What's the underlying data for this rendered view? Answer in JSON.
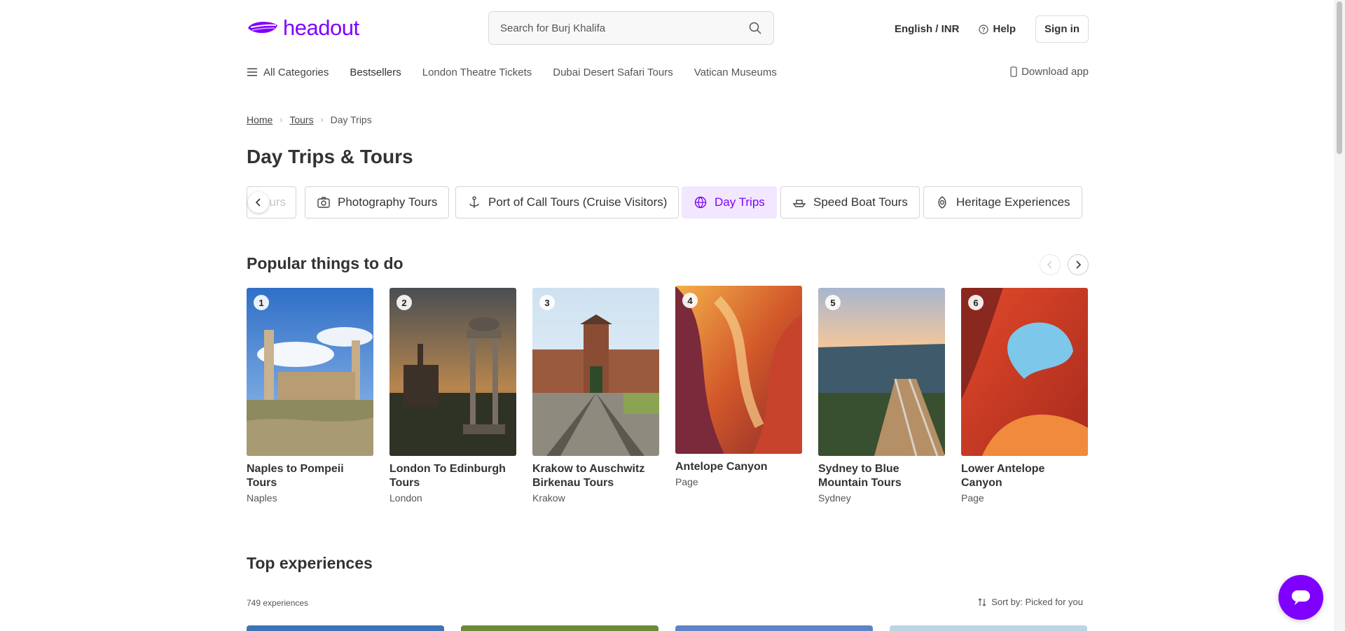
{
  "header": {
    "logo_text": "headout",
    "search_placeholder": "Search for Burj Khalifa",
    "language": "English / INR",
    "help_label": "Help",
    "signin_label": "Sign in"
  },
  "nav": {
    "all_categories": "All Categories",
    "items": [
      "Bestsellers",
      "London Theatre Tickets",
      "Dubai Desert Safari Tours",
      "Vatican Museums"
    ],
    "download_app": "Download app"
  },
  "breadcrumb": [
    "Home",
    "Tours",
    "Day Trips"
  ],
  "page_title": "Day Trips & Tours",
  "categories": {
    "partial_label": "urs",
    "chips": [
      {
        "label": "Photography Tours",
        "icon": "camera-icon",
        "active": false
      },
      {
        "label": "Port of Call Tours (Cruise Visitors)",
        "icon": "anchor-icon",
        "active": false
      },
      {
        "label": "Day Trips",
        "icon": "globe-icon",
        "active": true
      },
      {
        "label": "Speed Boat Tours",
        "icon": "boat-icon",
        "active": false
      },
      {
        "label": "Heritage Experiences",
        "icon": "heritage-icon",
        "active": false
      }
    ]
  },
  "popular": {
    "title": "Popular things to do",
    "cards": [
      {
        "rank": "1",
        "name": "Naples to Pompeii Tours",
        "city": "Naples"
      },
      {
        "rank": "2",
        "name": "London To Edinburgh Tours",
        "city": "London"
      },
      {
        "rank": "3",
        "name": "Krakow to Auschwitz Birkenau Tours",
        "city": "Krakow"
      },
      {
        "rank": "4",
        "name": "Antelope Canyon",
        "city": "Page"
      },
      {
        "rank": "5",
        "name": "Sydney to Blue Mountain Tours",
        "city": "Sydney"
      },
      {
        "rank": "6",
        "name": "Lower Antelope Canyon",
        "city": "Page"
      }
    ]
  },
  "top_experiences": {
    "title": "Top experiences",
    "count": "749 experiences",
    "sort_label": "Sort by: Picked for you"
  },
  "colors": {
    "brand": "#8000ff",
    "active_chip_bg": "#f2e7ff"
  }
}
